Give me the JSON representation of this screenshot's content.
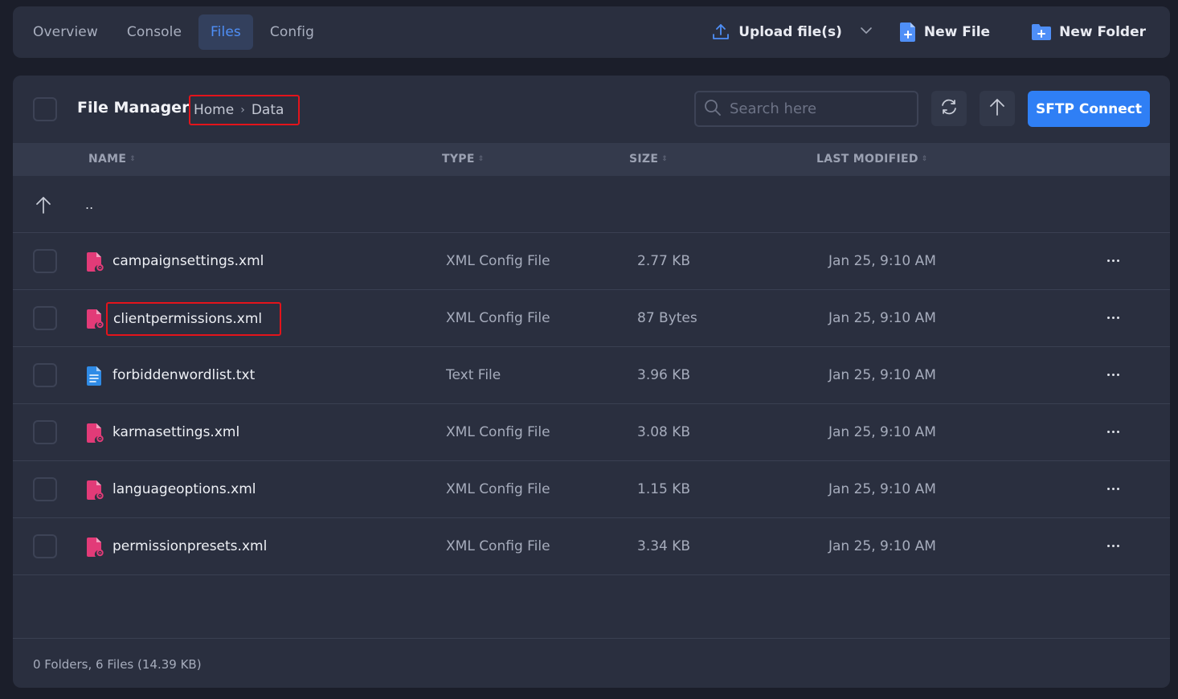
{
  "nav": {
    "tabs": [
      {
        "label": "Overview"
      },
      {
        "label": "Console"
      },
      {
        "label": "Files"
      },
      {
        "label": "Config"
      }
    ],
    "active_tab": "Files",
    "upload_label": "Upload file(s)",
    "new_file_label": "New File",
    "new_folder_label": "New Folder"
  },
  "file_manager": {
    "title": "File Manager",
    "breadcrumb": [
      "Home",
      "Data"
    ],
    "search_placeholder": "Search here",
    "sftp_label": "SFTP Connect"
  },
  "table": {
    "headers": {
      "name": "NAME",
      "type": "TYPE",
      "size": "SIZE",
      "modified": "LAST MODIFIED"
    },
    "parent_label": "..",
    "rows": [
      {
        "name": "campaignsettings.xml",
        "type": "XML Config File",
        "size": "2.77 KB",
        "modified": "Jan 25, 9:10 AM",
        "icon": "xml-config-file-icon"
      },
      {
        "name": "clientpermissions.xml",
        "type": "XML Config File",
        "size": "87 Bytes",
        "modified": "Jan 25, 9:10 AM",
        "icon": "xml-config-file-icon"
      },
      {
        "name": "forbiddenwordlist.txt",
        "type": "Text File",
        "size": "3.96 KB",
        "modified": "Jan 25, 9:10 AM",
        "icon": "text-file-icon"
      },
      {
        "name": "karmasettings.xml",
        "type": "XML Config File",
        "size": "3.08 KB",
        "modified": "Jan 25, 9:10 AM",
        "icon": "xml-config-file-icon"
      },
      {
        "name": "languageoptions.xml",
        "type": "XML Config File",
        "size": "1.15 KB",
        "modified": "Jan 25, 9:10 AM",
        "icon": "xml-config-file-icon"
      },
      {
        "name": "permissionpresets.xml",
        "type": "XML Config File",
        "size": "3.34 KB",
        "modified": "Jan 25, 9:10 AM",
        "icon": "xml-config-file-icon"
      }
    ]
  },
  "footer": {
    "summary": "0 Folders, 6 Files (14.39 KB)"
  },
  "colors": {
    "accent": "#2f7ff5",
    "xml_icon": "#e23b78",
    "text_icon": "#2f8be6",
    "highlight_box": "#e3141b"
  }
}
